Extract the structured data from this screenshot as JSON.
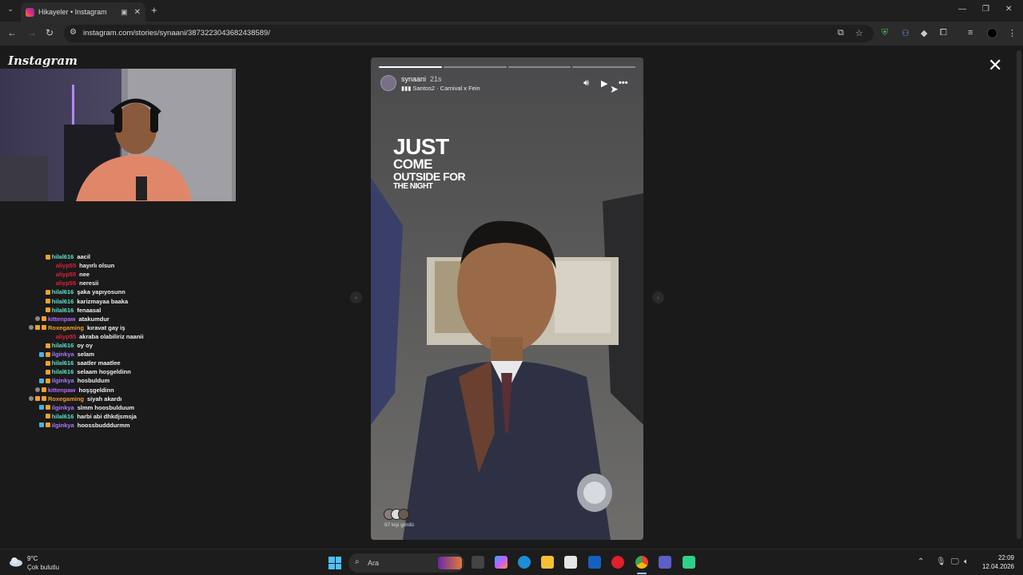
{
  "browser": {
    "tab_title": "Hikayeler • Instagram",
    "url": "instagram.com/stories/synaani/3873223043682438589/",
    "extension_badge": "50"
  },
  "page": {
    "logo": "Instagram",
    "close_label": "✕"
  },
  "chat": [
    {
      "user": "hilal616",
      "msg": "aacil",
      "color": "#5ee0c8",
      "badges": [
        "orange"
      ]
    },
    {
      "user": "aliyp55",
      "msg": "hayırlı olsun",
      "color": "#e0203a",
      "badges": []
    },
    {
      "user": "aliyp55",
      "msg": "nee",
      "color": "#e0203a",
      "badges": []
    },
    {
      "user": "aliyp55",
      "msg": "neresii",
      "color": "#e0203a",
      "badges": []
    },
    {
      "user": "hilal616",
      "msg": "şaka yapıyosunn",
      "color": "#5ee0c8",
      "badges": [
        "orange"
      ]
    },
    {
      "user": "hilal616",
      "msg": "karizmayaa baaka",
      "color": "#5ee0c8",
      "badges": [
        "orange"
      ]
    },
    {
      "user": "hilal616",
      "msg": "fenaasal",
      "color": "#5ee0c8",
      "badges": [
        "orange"
      ]
    },
    {
      "user": "kittenpaw",
      "msg": "atakumdur",
      "color": "#b66bff",
      "badges": [
        "gray",
        "orange"
      ]
    },
    {
      "user": "Roxegaming",
      "msg": "kıravat gay iş",
      "color": "#f0a030",
      "badges": [
        "gray",
        "orange",
        "orange"
      ]
    },
    {
      "user": "aliyp55",
      "msg": "akraba olabiliriz naanii",
      "color": "#e0203a",
      "badges": []
    },
    {
      "user": "hilal616",
      "msg": "oy oy",
      "color": "#5ee0c8",
      "badges": [
        "orange"
      ]
    },
    {
      "user": "ilginkya",
      "msg": "selam",
      "color": "#a47cff",
      "badges": [
        "blue",
        "orange"
      ]
    },
    {
      "user": "hilal616",
      "msg": "saatler maatlee",
      "color": "#5ee0c8",
      "badges": [
        "orange"
      ]
    },
    {
      "user": "hilal616",
      "msg": "selaam hoşgeldinn",
      "color": "#5ee0c8",
      "badges": [
        "orange"
      ]
    },
    {
      "user": "ilginkya",
      "msg": "hosbuldum",
      "color": "#a47cff",
      "badges": [
        "blue",
        "orange"
      ]
    },
    {
      "user": "kittenpaw",
      "msg": "hoşşgeldinn",
      "color": "#b66bff",
      "badges": [
        "gray",
        "orange"
      ]
    },
    {
      "user": "Roxegaming",
      "msg": "siyah akardı",
      "color": "#f0a030",
      "badges": [
        "gray",
        "orange",
        "orange"
      ]
    },
    {
      "user": "ilginkya",
      "msg": "slmm hoosbulduum",
      "color": "#a47cff",
      "badges": [
        "blue",
        "orange"
      ]
    },
    {
      "user": "hilal616",
      "msg": "harbi abi dhkdjsmsja",
      "color": "#5ee0c8",
      "badges": [
        "orange"
      ]
    },
    {
      "user": "ilginkya",
      "msg": "hoossbudddurmm",
      "color": "#a47cff",
      "badges": [
        "blue",
        "orange"
      ]
    }
  ],
  "story": {
    "username": "synaani",
    "time": "21s",
    "music": "Santos2 · Carnival x Fein",
    "overlay_lines": [
      "JUST",
      "COME",
      "OUTSIDE FOR",
      "THE NIGHT"
    ],
    "seen_by": "97 kişi gördü",
    "segments": 4,
    "segments_done": 1
  },
  "taskbar": {
    "temperature": "9°C",
    "condition": "Çok bulutlu",
    "search_placeholder": "Ara",
    "time": "22:09",
    "date": "12.04.2026"
  }
}
